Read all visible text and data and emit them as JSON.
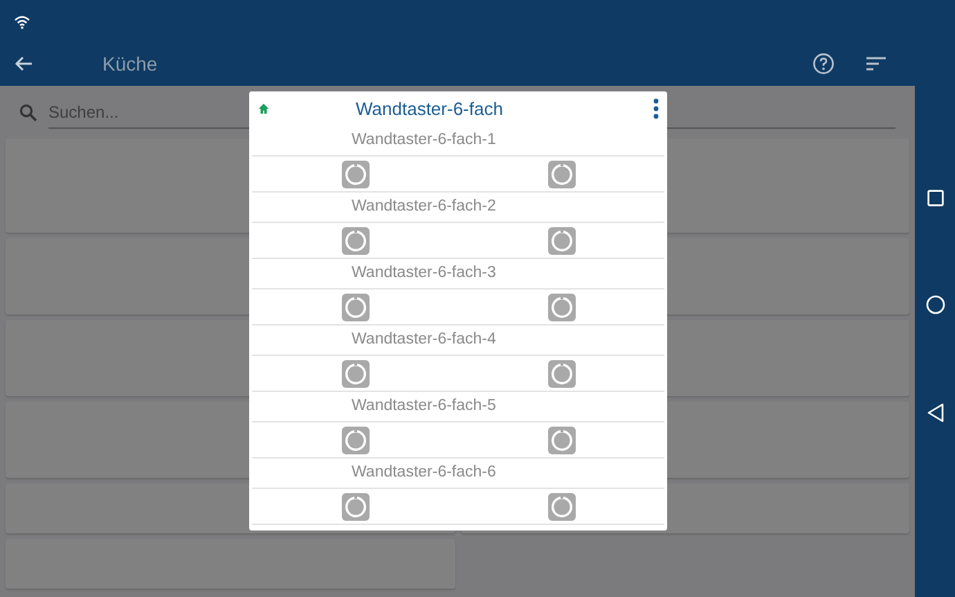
{
  "app_bar": {
    "title": "Küche"
  },
  "search": {
    "placeholder": "Suchen..."
  },
  "dialog": {
    "title": "Wandtaster-6-fach",
    "channels": [
      {
        "label": "Wandtaster-6-fach-1",
        "buttons": [
          {
            "kind": "switch"
          },
          {
            "kind": "switch"
          }
        ]
      },
      {
        "label": "Wandtaster-6-fach-2",
        "buttons": [
          {
            "kind": "switch"
          },
          {
            "kind": "switch"
          }
        ]
      },
      {
        "label": "Wandtaster-6-fach-3",
        "buttons": [
          {
            "kind": "switch"
          },
          {
            "kind": "switch"
          }
        ]
      },
      {
        "label": "Wandtaster-6-fach-4",
        "buttons": [
          {
            "kind": "switch"
          },
          {
            "kind": "switch"
          }
        ]
      },
      {
        "label": "Wandtaster-6-fach-5",
        "buttons": [
          {
            "kind": "switch"
          },
          {
            "kind": "switch"
          }
        ]
      },
      {
        "label": "Wandtaster-6-fach-6",
        "buttons": [
          {
            "kind": "switch"
          },
          {
            "kind": "switch"
          }
        ]
      }
    ]
  }
}
